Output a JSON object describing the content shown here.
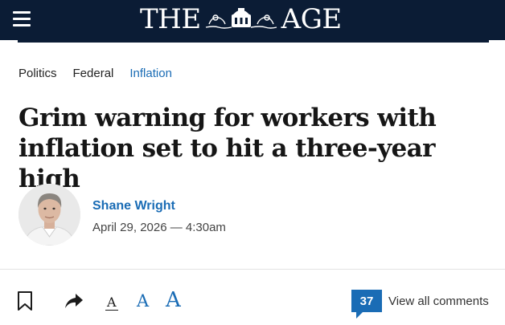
{
  "header": {
    "masthead_left": "THE",
    "masthead_right": "AGE",
    "background": "#0b1c35"
  },
  "breadcrumbs": [
    "Politics",
    "Federal",
    "Inflation"
  ],
  "article": {
    "headline": "Grim warning for workers with inflation set to hit a three-year high",
    "author": "Shane Wright",
    "date": "April 29, 2026 — 4:30am"
  },
  "toolbar": {
    "font_small": "A",
    "font_medium": "A",
    "font_large": "A",
    "comment_count": "37",
    "comments_label": "View all comments"
  },
  "colors": {
    "accent": "#1a6cb5",
    "text": "#161616"
  }
}
